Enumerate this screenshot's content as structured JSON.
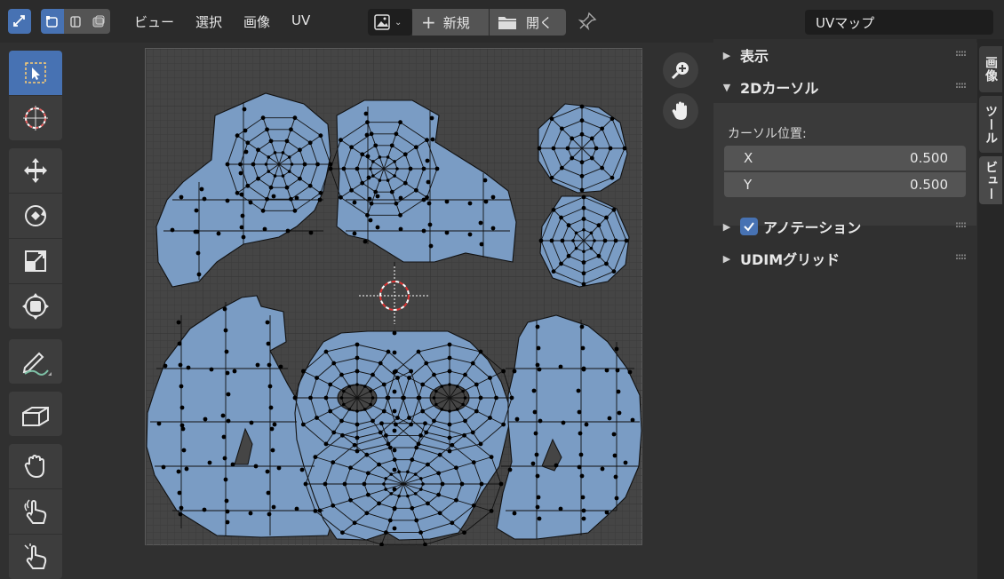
{
  "header": {
    "menus": [
      "ビュー",
      "選択",
      "画像",
      "UV"
    ],
    "new_label": "新規",
    "open_label": "開く",
    "uv_map_name": "UVマップ"
  },
  "toolbar": {
    "tools": [
      "select-box",
      "cursor",
      "move",
      "rotate",
      "scale",
      "transform",
      "annotate",
      "rip-region",
      "grab",
      "relax",
      "pinch"
    ],
    "active_tool": "select-box"
  },
  "npanel": {
    "sections": {
      "display": "表示",
      "cursor2d": "2Dカーソル",
      "annotation": "アノテーション",
      "udim": "UDIMグリッド"
    },
    "cursor_location_label": "カーソル位置:",
    "x_label": "X",
    "x_value": "0.500",
    "y_label": "Y",
    "y_value": "0.500",
    "annotation_checked": true
  },
  "side_tabs": [
    "画像",
    "ツール",
    "ビュー"
  ],
  "colors": {
    "accent": "#4772b3",
    "uv_island": "#7a9cc4",
    "background": "#303030"
  }
}
